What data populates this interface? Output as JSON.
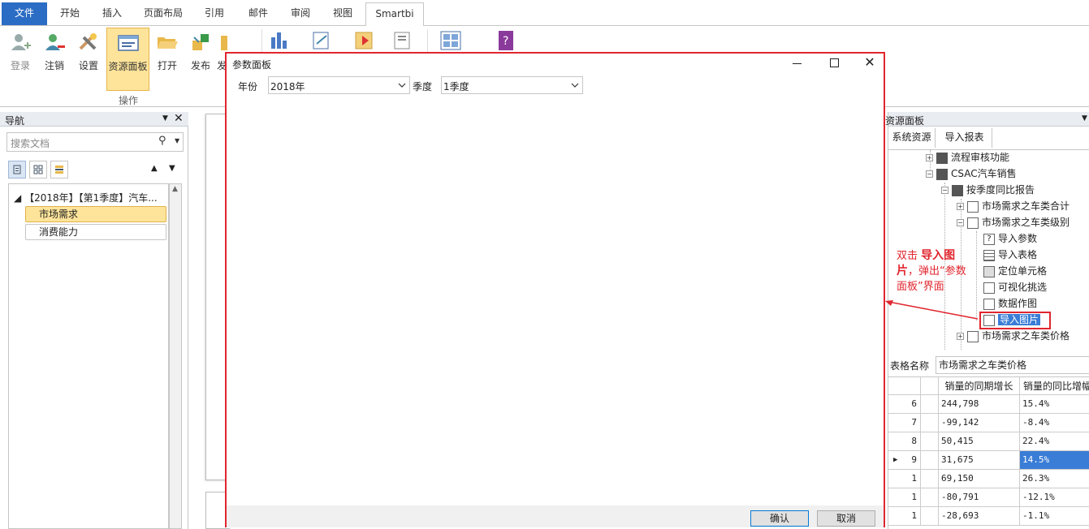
{
  "ribbon": {
    "tabs": [
      {
        "label": "文件"
      },
      {
        "label": "开始"
      },
      {
        "label": "插入"
      },
      {
        "label": "页面布局"
      },
      {
        "label": "引用"
      },
      {
        "label": "邮件"
      },
      {
        "label": "审阅"
      },
      {
        "label": "视图"
      },
      {
        "label": "Smartbi"
      }
    ],
    "buttons": {
      "login": "登录",
      "logout": "注销",
      "settings": "设置",
      "resource_panel": "资源面板",
      "open": "打开",
      "publish": "发布",
      "publish2": "发"
    },
    "group_label": "操作"
  },
  "nav": {
    "title": "导航",
    "search_placeholder": "搜索文档",
    "root": "【2018年】【第1季度】汽车...",
    "items": [
      "市场需求",
      "消费能力"
    ]
  },
  "resource": {
    "title": "资源面板",
    "tabs": [
      "系统资源",
      "导入报表"
    ],
    "tree": [
      "流程审核功能",
      "CSAC汽车销售",
      "按季度同比报告",
      "市场需求之车类合计",
      "市场需求之车类级别",
      "导入参数",
      "导入表格",
      "定位单元格",
      "可视化挑选",
      "数据作图",
      "导入图片",
      "市场需求之车类价格"
    ],
    "annotation": {
      "pre": "双击 ",
      "bold": "导入图片",
      "post": "，弹出“参数面板”界面"
    },
    "table_name_label": "表格名称",
    "table_name_value": "市场需求之车类价格",
    "grid": {
      "headers": [
        "销量的同期增长",
        "销量的同比增幅"
      ],
      "rows": [
        {
          "idx": "6",
          "a": "244,798",
          "b": "15.4%"
        },
        {
          "idx": "7",
          "a": "-99,142",
          "b": "-8.4%"
        },
        {
          "idx": "8",
          "a": "50,415",
          "b": "22.4%"
        },
        {
          "idx": "9",
          "a": "31,675",
          "b": "14.5%"
        },
        {
          "idx": "1",
          "a": "69,150",
          "b": "26.3%"
        },
        {
          "idx": "1",
          "a": "-80,791",
          "b": "-12.1%"
        },
        {
          "idx": "1",
          "a": "-28,693",
          "b": "-1.1%"
        }
      ]
    }
  },
  "dialog": {
    "title": "参数面板",
    "year_label": "年份",
    "year_value": "2018年",
    "quarter_label": "季度",
    "quarter_value": "1季度",
    "ok": "确认",
    "cancel": "取消"
  },
  "colors": {
    "accent": "#2b6cc4",
    "highlight": "#e0262e",
    "selection": "#fde49a"
  }
}
